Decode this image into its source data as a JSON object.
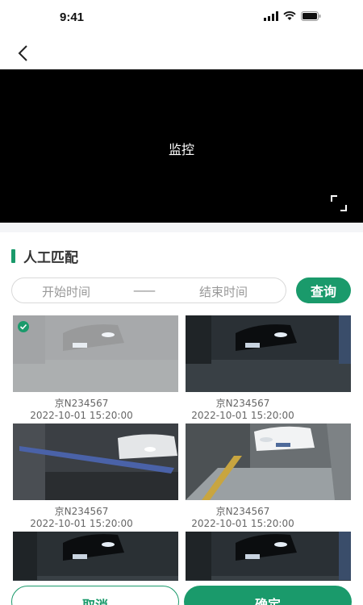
{
  "status_bar": {
    "time": "9:41"
  },
  "video": {
    "label": "监控"
  },
  "section": {
    "title": "人工匹配"
  },
  "filter": {
    "start_placeholder": "开始时间",
    "separator": "——",
    "end_placeholder": "结束时间",
    "query_label": "查询"
  },
  "records": [
    {
      "plate": "京N234567",
      "time": "2022-10-01 15:20:00",
      "selected": true
    },
    {
      "plate": "京N234567",
      "time": "2022-10-01 15:20:00",
      "selected": false
    },
    {
      "plate": "京N234567",
      "time": "2022-10-01 15:20:00",
      "selected": false
    },
    {
      "plate": "京N234567",
      "time": "2022-10-01 15:20:00",
      "selected": false
    },
    {
      "plate": "",
      "time": "",
      "selected": false
    },
    {
      "plate": "",
      "time": "",
      "selected": false
    }
  ],
  "actions": {
    "cancel_label": "取消",
    "confirm_label": "确定"
  },
  "colors": {
    "accent": "#1a9a6b",
    "video_bg": "#000000"
  }
}
